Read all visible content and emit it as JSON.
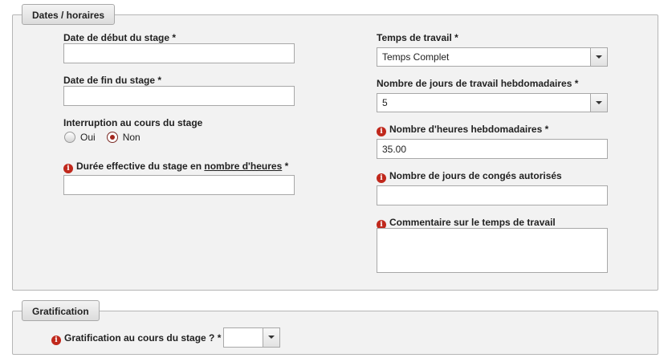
{
  "dates_section": {
    "legend": "Dates / horaires",
    "start_date": {
      "label": "Date de début du stage *",
      "value": ""
    },
    "end_date": {
      "label": "Date de fin du stage *",
      "value": ""
    },
    "interruption": {
      "label": "Interruption au cours du stage",
      "options": [
        "Oui",
        "Non"
      ],
      "selected": "Non"
    },
    "duration": {
      "label_prefix": "Durée effective du stage en ",
      "label_link": "nombre d'heures",
      "label_suffix": " *",
      "value": ""
    },
    "work_time": {
      "label": "Temps de travail *",
      "value": "Temps Complet"
    },
    "weekly_days": {
      "label": "Nombre de jours de travail hebdomadaires *",
      "value": "5"
    },
    "weekly_hours": {
      "label": "Nombre d'heures hebdomadaires *",
      "value": "35.00"
    },
    "leave_days": {
      "label": "Nombre de jours de congés autorisés",
      "value": ""
    },
    "work_time_comment": {
      "label": "Commentaire sur le temps de travail",
      "value": ""
    }
  },
  "gratification_section": {
    "legend": "Gratification",
    "question": {
      "label": "Gratification au cours du stage ? *",
      "value": ""
    }
  },
  "icons": {
    "info": "info-circle-icon",
    "dropdown": "chevron-down-icon"
  },
  "colors": {
    "info_icon": "#c0281c",
    "panel_bg": "#f2f2f2",
    "panel_border": "#b5b5b5"
  }
}
